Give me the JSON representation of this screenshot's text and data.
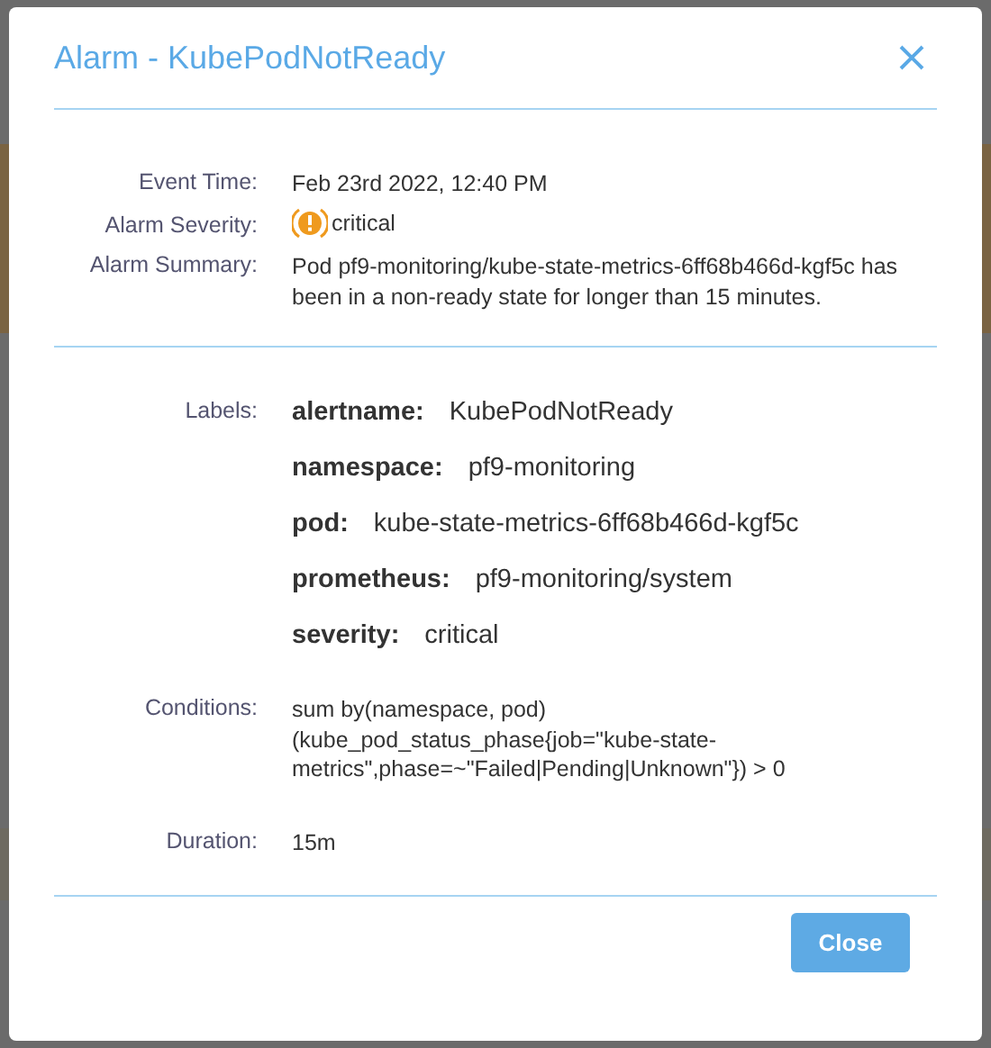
{
  "dialog": {
    "title": "Alarm - KubePodNotReady",
    "details": [
      {
        "kind": "text",
        "label": "Event Time:",
        "value": "Feb 23rd 2022, 12:40 PM"
      },
      {
        "kind": "severity",
        "label": "Alarm Severity:",
        "value": "critical"
      },
      {
        "kind": "text",
        "label": "Alarm Summary:",
        "value": "Pod pf9-monitoring/kube-state-metrics-6ff68b466d-kgf5c has been in a non-ready state for longer than 15 minutes."
      }
    ],
    "labels": {
      "label": "Labels:",
      "items": [
        {
          "key": "alertname:",
          "value": "KubePodNotReady"
        },
        {
          "key": "namespace:",
          "value": "pf9-monitoring"
        },
        {
          "key": "pod:",
          "value": "kube-state-metrics-6ff68b466d-kgf5c"
        },
        {
          "key": "prometheus:",
          "value": "pf9-monitoring/system"
        },
        {
          "key": "severity:",
          "value": "critical"
        }
      ]
    },
    "extra": [
      {
        "label": "Conditions:",
        "value": "sum by(namespace, pod) (kube_pod_status_phase{job=\"kube-state-metrics\",phase=~\"Failed|Pending|Unknown\"}) > 0"
      },
      {
        "label": "Duration:",
        "value": "15m"
      }
    ],
    "buttons": [
      "Close"
    ]
  }
}
